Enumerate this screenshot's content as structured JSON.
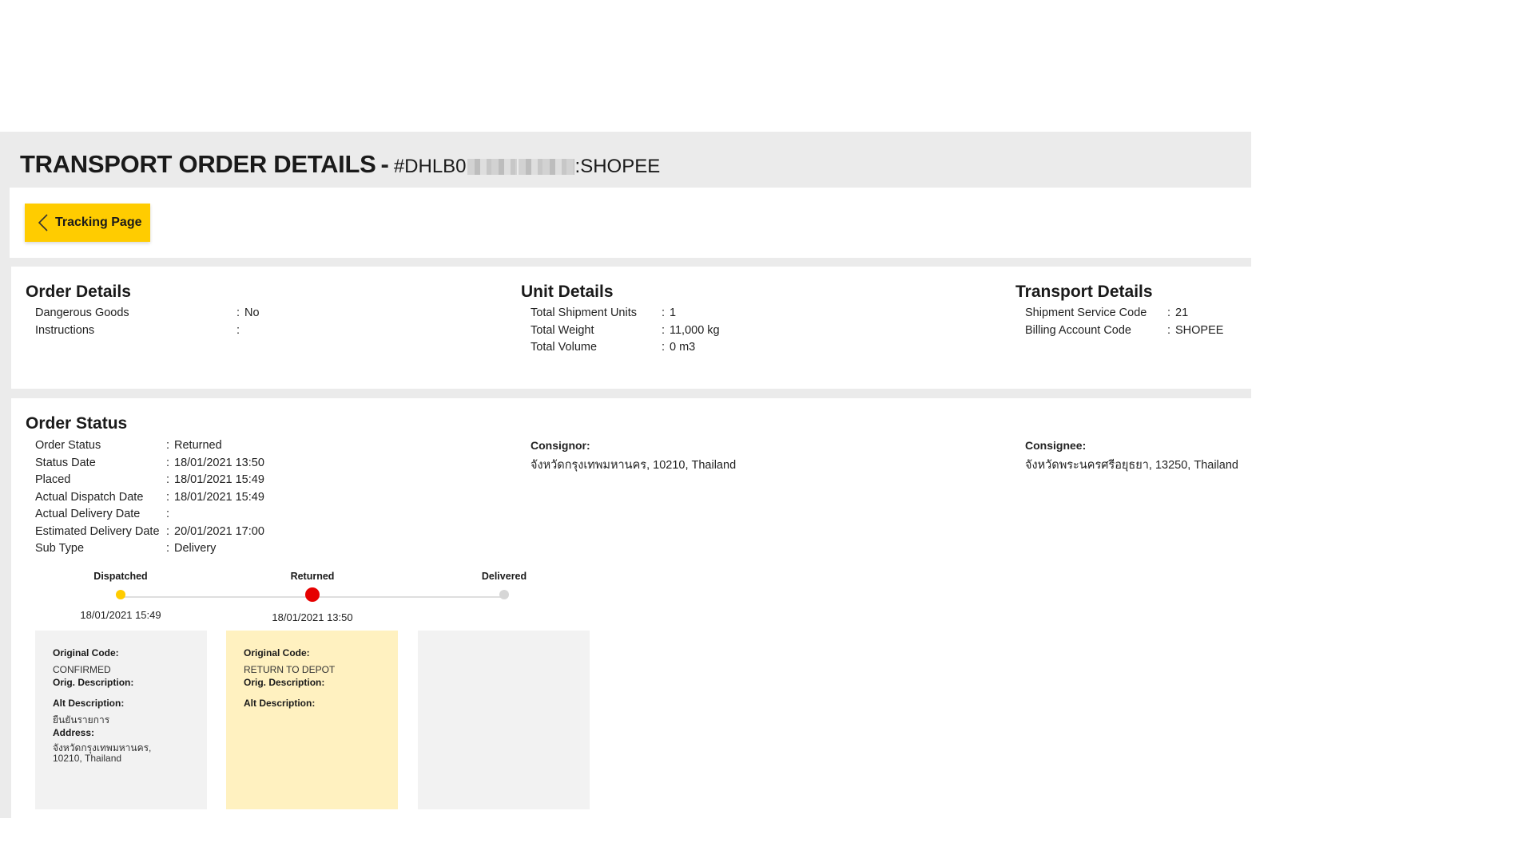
{
  "header": {
    "title": "TRANSPORT ORDER DETAILS",
    "dash": "-",
    "order_id_prefix": "#DHLB0",
    "order_id_suffix": ":SHOPEE"
  },
  "nav": {
    "back_label": "Tracking Page"
  },
  "order_details": {
    "title": "Order Details",
    "rows": [
      {
        "label": "Dangerous Goods",
        "value": "No"
      },
      {
        "label": "Instructions",
        "value": ""
      }
    ]
  },
  "unit_details": {
    "title": "Unit Details",
    "rows": [
      {
        "label": "Total Shipment Units",
        "value": "1"
      },
      {
        "label": "Total Weight",
        "value": "11,000 kg"
      },
      {
        "label": "Total Volume",
        "value": "0 m3"
      }
    ]
  },
  "transport_details": {
    "title": "Transport Details",
    "rows": [
      {
        "label": "Shipment Service Code",
        "value": "21"
      },
      {
        "label": "Billing Account Code",
        "value": "SHOPEE"
      }
    ]
  },
  "order_status": {
    "title": "Order Status",
    "rows": [
      {
        "label": "Order Status",
        "value": "Returned"
      },
      {
        "label": "Status Date",
        "value": "18/01/2021 13:50"
      },
      {
        "label": "Placed",
        "value": "18/01/2021 15:49"
      },
      {
        "label": "Actual Dispatch Date",
        "value": "18/01/2021 15:49"
      },
      {
        "label": "Actual Delivery Date",
        "value": ""
      },
      {
        "label": "Estimated Delivery Date",
        "value": "20/01/2021 17:00"
      },
      {
        "label": "Sub Type",
        "value": "Delivery"
      }
    ],
    "consignor": {
      "label": "Consignor:",
      "address": "จังหวัดกรุงเทพมหานคร, 10210, Thailand"
    },
    "consignee": {
      "label": "Consignee:",
      "address": "จังหวัดพระนครศรีอยุธยา, 13250, Thailand"
    }
  },
  "timeline": {
    "steps": [
      {
        "name": "Dispatched",
        "date": "18/01/2021 15:49",
        "state": "done"
      },
      {
        "name": "Returned",
        "date": "18/01/2021 13:50",
        "state": "current"
      },
      {
        "name": "Delivered",
        "date": "",
        "state": "pending"
      }
    ]
  },
  "events": [
    {
      "original_code_label": "Original Code:",
      "original_code": "CONFIRMED",
      "orig_desc_label": "Orig. Description:",
      "alt_desc_label": "Alt Description:",
      "alt_desc": "ยืนยันรายการ",
      "address_label": "Address:",
      "address": "จังหวัดกรุงเทพมหานคร, 10210, Thailand"
    },
    {
      "original_code_label": "Original Code:",
      "original_code": "RETURN TO DEPOT",
      "orig_desc_label": "Orig. Description:",
      "alt_desc_label": "Alt Description:"
    }
  ],
  "colors": {
    "brand_yellow": "#ffcc00",
    "returned_red": "#e60000",
    "pending_gray": "#d6d6d6",
    "active_card": "#fff1c0"
  }
}
